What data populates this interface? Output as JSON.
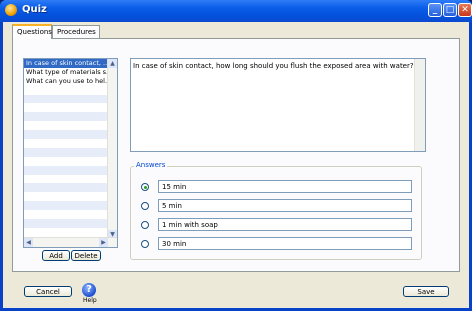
{
  "window": {
    "title": "Quiz",
    "minimize_glyph": "_",
    "maximize_glyph": "□",
    "close_glyph": "✕"
  },
  "tabs": [
    {
      "label": "Questions",
      "active": true
    },
    {
      "label": "Procedures",
      "active": false
    }
  ],
  "question_list": {
    "items": [
      "In case of skin contact, ...",
      "What type of materials s...",
      "What can you use to hel..."
    ],
    "selected_index": 0,
    "add_label": "Add",
    "delete_label": "Delete"
  },
  "question_text": "In case of skin contact, how long should you flush the exposed area with water?",
  "answers": {
    "legend": "Answers",
    "selected_index": 0,
    "options": [
      "15 min",
      "5 min",
      "1 min with soap",
      "30 min"
    ]
  },
  "footer": {
    "cancel_label": "Cancel",
    "help_label": "Help",
    "help_icon_glyph": "?",
    "save_label": "Save"
  }
}
